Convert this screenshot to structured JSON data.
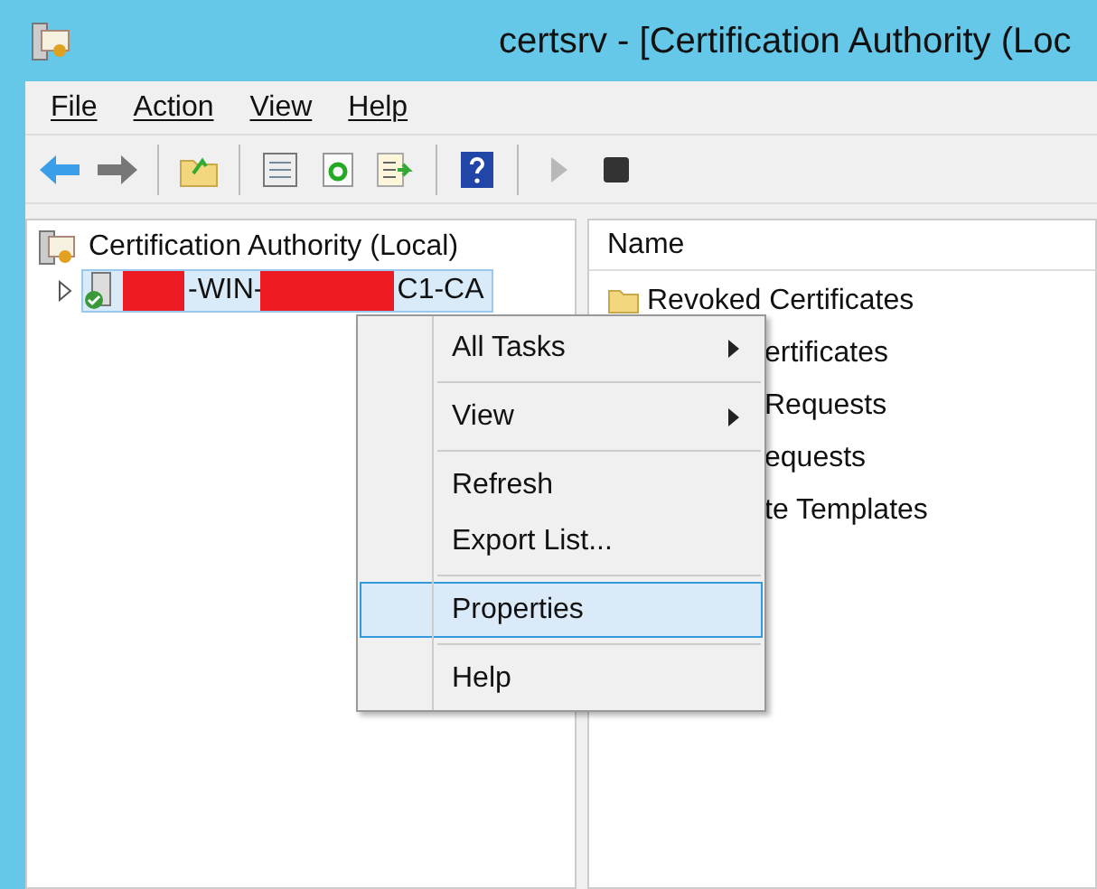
{
  "window": {
    "title": "certsrv - [Certification Authority (Loc"
  },
  "menu_bar": [
    "File",
    "Action",
    "View",
    "Help"
  ],
  "toolbar": [
    {
      "kind": "back",
      "disabled": false
    },
    {
      "kind": "forward",
      "disabled": false
    },
    {
      "kind": "sep"
    },
    {
      "kind": "up",
      "disabled": false
    },
    {
      "kind": "sep"
    },
    {
      "kind": "properties",
      "disabled": false
    },
    {
      "kind": "refresh",
      "disabled": false
    },
    {
      "kind": "export",
      "disabled": false
    },
    {
      "kind": "sep"
    },
    {
      "kind": "help",
      "disabled": false
    },
    {
      "kind": "sep"
    },
    {
      "kind": "play",
      "disabled": true
    },
    {
      "kind": "stop",
      "disabled": false
    }
  ],
  "tree": {
    "root": "Certification Authority (Local)",
    "children": [
      {
        "label_parts": [
          "-WIN-",
          "C1-CA"
        ],
        "selected": true,
        "expanded": false
      }
    ]
  },
  "list": {
    "columns": [
      "Name"
    ],
    "rows": [
      {
        "name": "Revoked Certificates",
        "covered": false
      },
      {
        "name": "ertificates",
        "covered": true
      },
      {
        "name": "Requests",
        "covered": true
      },
      {
        "name": "equests",
        "covered": true
      },
      {
        "name": "te Templates",
        "covered": true
      }
    ]
  },
  "context_menu": {
    "items": [
      {
        "kind": "item",
        "label": "All Tasks",
        "submenu": true,
        "selected": false
      },
      {
        "kind": "sep"
      },
      {
        "kind": "item",
        "label": "View",
        "submenu": true,
        "selected": false
      },
      {
        "kind": "sep"
      },
      {
        "kind": "item",
        "label": "Refresh",
        "submenu": false,
        "selected": false
      },
      {
        "kind": "item",
        "label": "Export List...",
        "submenu": false,
        "selected": false
      },
      {
        "kind": "sep"
      },
      {
        "kind": "item",
        "label": "Properties",
        "submenu": false,
        "selected": true
      },
      {
        "kind": "sep"
      },
      {
        "kind": "item",
        "label": "Help",
        "submenu": false,
        "selected": false
      }
    ]
  }
}
